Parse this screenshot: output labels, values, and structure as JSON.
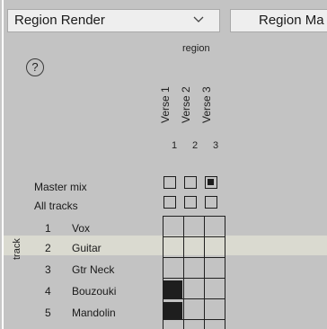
{
  "toolbar": {
    "source_value": "Region Render",
    "second_button_label": "Region Ma"
  },
  "help": {
    "glyph": "?"
  },
  "matrix": {
    "region_axis_label": "region",
    "track_axis_label": "track",
    "master_mix_label": "Master mix",
    "all_tracks_label": "All tracks",
    "regions": [
      {
        "num": "1",
        "name": "Verse 1"
      },
      {
        "num": "2",
        "name": "Verse 2"
      },
      {
        "num": "3",
        "name": "Verse 3"
      }
    ],
    "master_mix_checked": [
      false,
      false,
      true
    ],
    "all_tracks_checked": [
      false,
      false,
      false
    ],
    "tracks": [
      {
        "num": "1",
        "name": "Vox",
        "cells": [
          false,
          false,
          false
        ]
      },
      {
        "num": "2",
        "name": "Guitar",
        "cells": [
          false,
          false,
          false
        ],
        "highlighted": true
      },
      {
        "num": "3",
        "name": "Gtr Neck",
        "cells": [
          false,
          false,
          false
        ]
      },
      {
        "num": "4",
        "name": "Bouzouki",
        "cells": [
          true,
          false,
          false
        ]
      },
      {
        "num": "5",
        "name": "Mandolin",
        "cells": [
          true,
          false,
          false
        ]
      }
    ]
  },
  "colors": {
    "panel_bg": "#c3c3c3",
    "highlight_row": "#dadad0",
    "cell_on": "#1e1e1e",
    "control_bg": "#eeeeee"
  }
}
